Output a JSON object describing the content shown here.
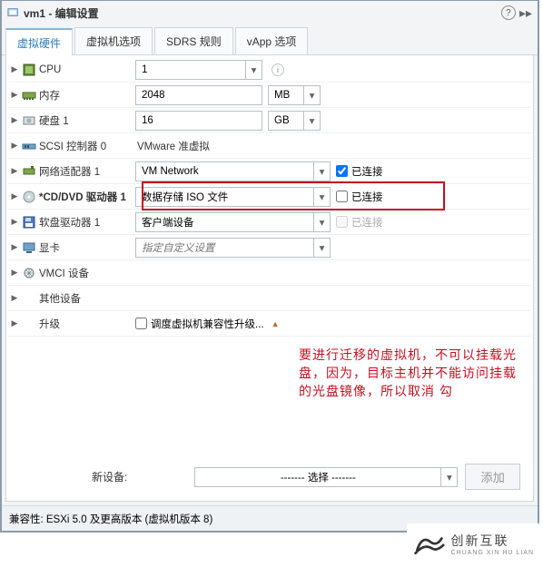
{
  "window": {
    "title": "vm1 - 编辑设置"
  },
  "tabs": {
    "t0": "虚拟硬件",
    "t1": "虚拟机选项",
    "t2": "SDRS 规则",
    "t3": "vApp 选项"
  },
  "rows": {
    "cpu": {
      "label": "CPU",
      "value": "1"
    },
    "mem": {
      "label": "内存",
      "value": "2048",
      "unit": "MB"
    },
    "disk": {
      "label": "硬盘 1",
      "value": "16",
      "unit": "GB"
    },
    "scsi": {
      "label": "SCSI 控制器 0",
      "value": "VMware 准虚拟"
    },
    "net": {
      "label": "网络适配器 1",
      "value": "VM Network",
      "conn": "已连接",
      "checked": true
    },
    "cd": {
      "label": "*CD/DVD 驱动器 1",
      "value": "数据存储 ISO 文件",
      "conn": "已连接",
      "checked": false
    },
    "floppy": {
      "label": "软盘驱动器 1",
      "value": "客户端设备",
      "conn": "已连接",
      "checked": false,
      "disabled": true
    },
    "video": {
      "label": "显卡",
      "value": "指定自定义设置"
    },
    "vmci": {
      "label": "VMCI 设备"
    },
    "other": {
      "label": "其他设备"
    },
    "upgrade": {
      "label": "升级",
      "checkbox": "调度虚拟机兼容性升级..."
    }
  },
  "annotation": "要进行迁移的虚拟机，不可以挂载光盘，因为，目标主机并不能访问挂载的光盘镜像，所以取消  勾",
  "footer": {
    "new_device": "新设备:",
    "select_placeholder": "------- 选择 -------",
    "add": "添加"
  },
  "compat": "兼容性: ESXi 5.0 及更高版本 (虚拟机版本 8)",
  "brand": {
    "name": "创新互联",
    "sub": "CHUANG XIN HU LIAN"
  }
}
